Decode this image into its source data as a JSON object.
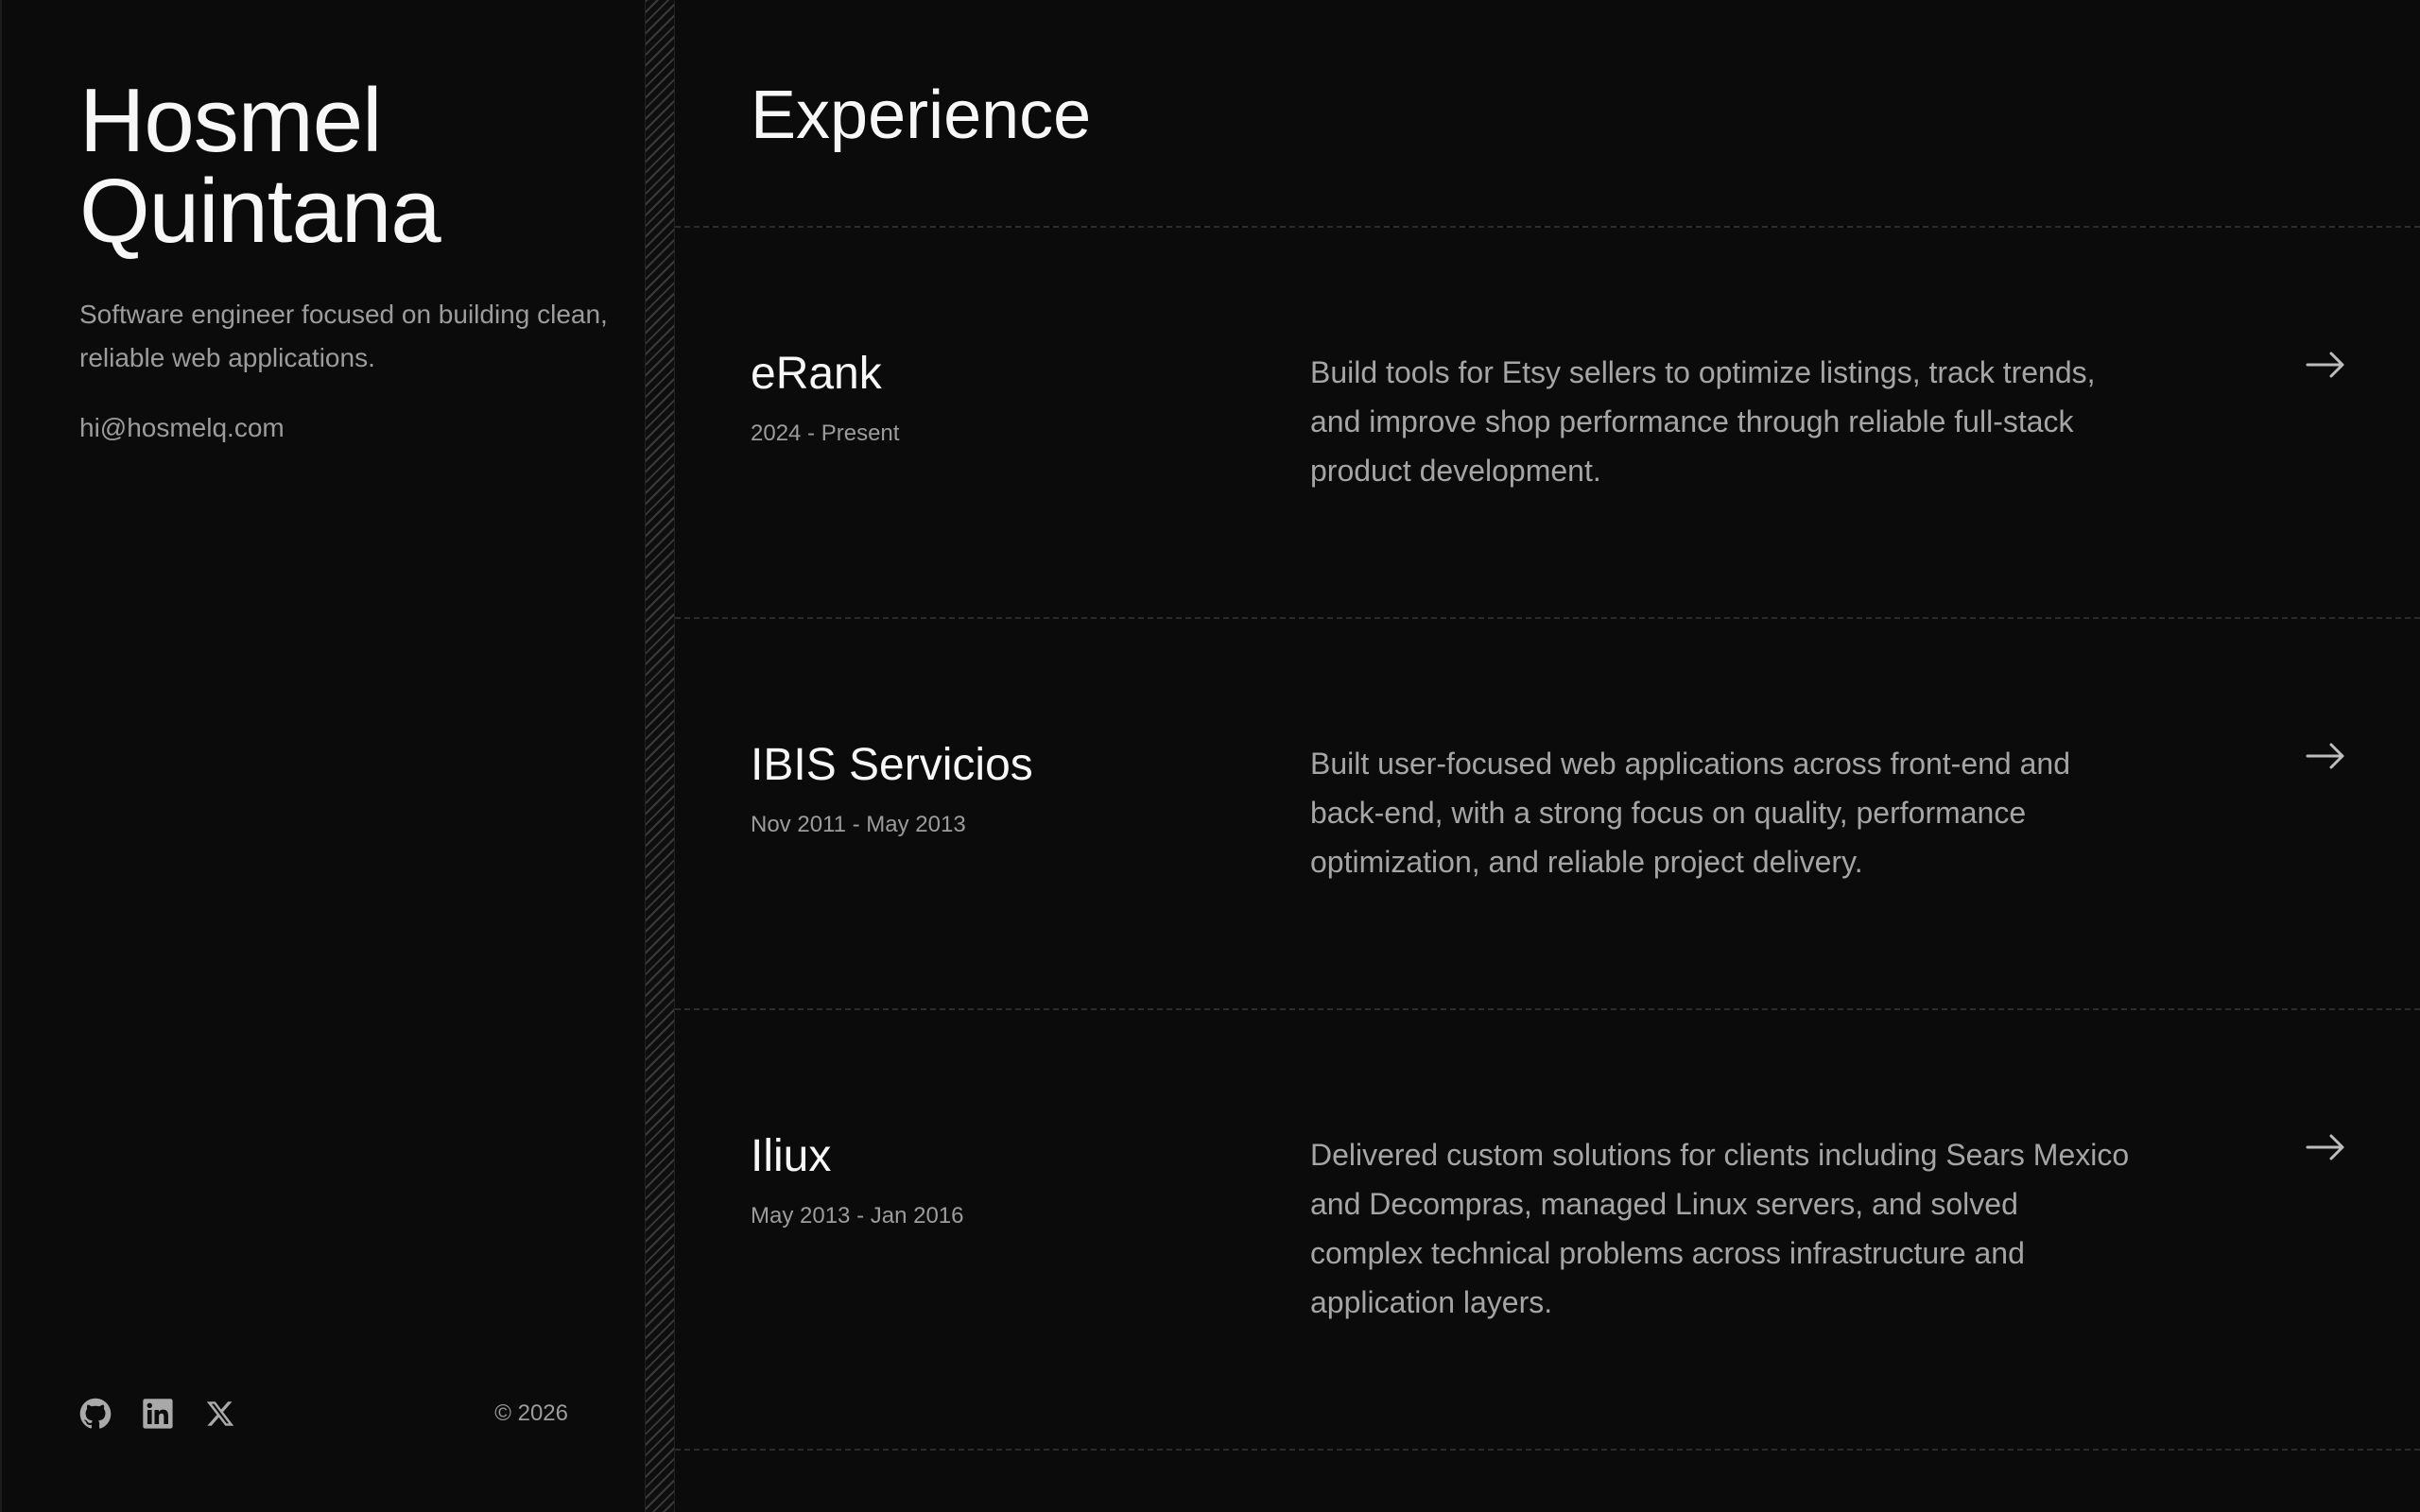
{
  "profile": {
    "name_line1": "Hosmel",
    "name_line2": "Quintana",
    "tagline": "Software engineer focused on building clean, reliable web applications.",
    "email": "hi@hosmelq.com",
    "copyright": "© 2026",
    "socials": [
      {
        "icon": "github-icon"
      },
      {
        "icon": "linkedin-icon"
      },
      {
        "icon": "x-icon"
      }
    ]
  },
  "main": {
    "title": "Experience",
    "items": [
      {
        "company": "eRank",
        "dates": "2024 - Present",
        "description": "Build tools for Etsy sellers to optimize listings, track trends, and improve shop performance through reliable full-stack product development."
      },
      {
        "company": "IBIS Servicios",
        "dates": "Nov 2011 - May 2013",
        "description": "Built user-focused web applications across front-end and back-end, with a strong focus on quality, performance optimization, and reliable project delivery."
      },
      {
        "company": "Iliux",
        "dates": "May 2013 - Jan 2016",
        "description": "Delivered custom solutions for clients including Sears Mexico and Decompras, managed Linux servers, and solved complex technical problems across infrastructure and application layers."
      }
    ]
  },
  "colors": {
    "background": "#0b0b0b",
    "text_primary": "#f7f7f7",
    "text_secondary": "#9c9c9c",
    "divider": "#2c2c2c"
  }
}
